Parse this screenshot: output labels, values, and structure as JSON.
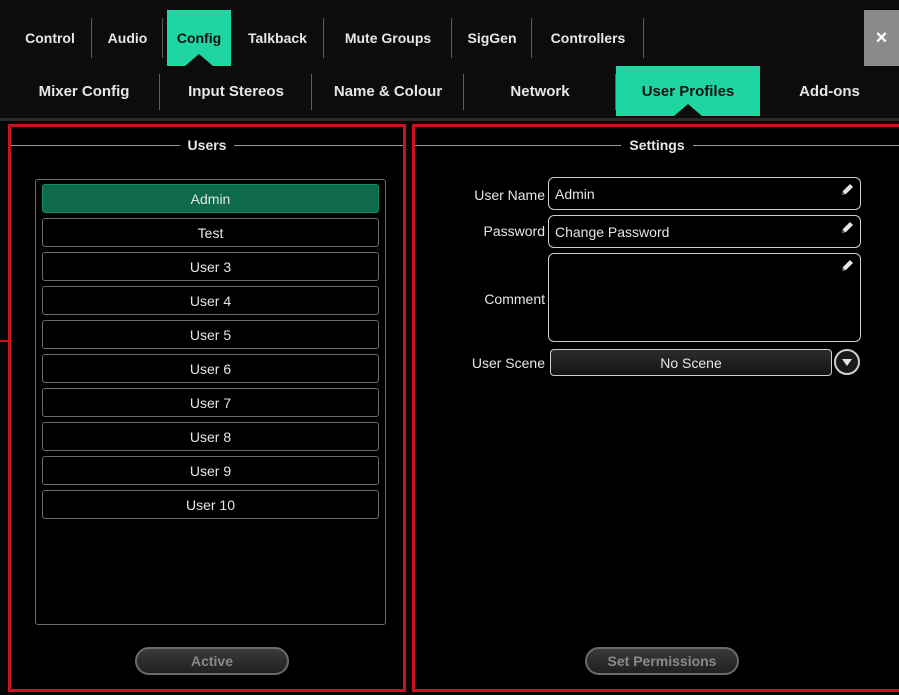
{
  "primary_tabs": [
    {
      "label": "Control"
    },
    {
      "label": "Audio"
    },
    {
      "label": "Config"
    },
    {
      "label": "Talkback"
    },
    {
      "label": "Mute Groups"
    },
    {
      "label": "SigGen"
    },
    {
      "label": "Controllers"
    }
  ],
  "close_label": "×",
  "secondary_tabs": [
    {
      "label": "Mixer Config"
    },
    {
      "label": "Input Stereos"
    },
    {
      "label": "Name & Colour"
    },
    {
      "label": "Network"
    },
    {
      "label": "User Profiles"
    },
    {
      "label": "Add-ons"
    }
  ],
  "users_panel": {
    "title": "Users",
    "users": [
      "Admin",
      "Test",
      "User 3",
      "User 4",
      "User 5",
      "User 6",
      "User 7",
      "User 8",
      "User 9",
      "User 10"
    ],
    "selected_user": "Admin",
    "active_button": "Active"
  },
  "settings_panel": {
    "title": "Settings",
    "user_name_label": "User Name",
    "user_name_value": "Admin",
    "password_label": "Password",
    "password_value": "Change Password",
    "comment_label": "Comment",
    "comment_value": "",
    "user_scene_label": "User Scene",
    "user_scene_value": "No Scene",
    "set_permissions_button": "Set Permissions"
  },
  "colors": {
    "accent": "#1fd6a3",
    "selected_row": "#0f6a4c",
    "panel_border": "#c8141e"
  },
  "icons": [
    "close-icon",
    "pencil-icon",
    "dropdown-arrow-icon"
  ]
}
